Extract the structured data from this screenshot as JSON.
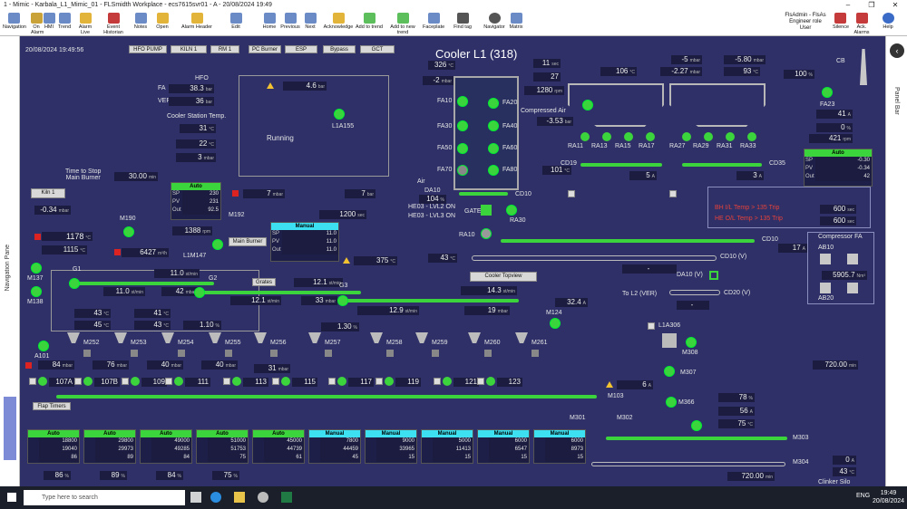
{
  "window": {
    "title": "1 - Mimic - Karbala_L1_Mimic_01 - FLSmidth Workplace - ecs7615svr01 - A - 20/08/2024 19:49",
    "controls": [
      "–",
      "❐",
      "✕"
    ]
  },
  "ribbon": {
    "items": [
      "Navigation",
      "On Alarm",
      "HMI",
      "Trend",
      "Alarm Live",
      "Event Historian",
      "Notes",
      "Open",
      "Alarm Header",
      "Edit",
      "Home",
      "Previous",
      "Next",
      "Acknowledge",
      "Add to trend",
      "Add to new trend",
      "Faceplate",
      "Find tag",
      "Navigator",
      "Matrix"
    ],
    "user": "FlsAdmin - FlsAs",
    "role": "Engineer role",
    "user_sub": "User",
    "right": [
      "Silence",
      "Ack. Alarms",
      "Help"
    ]
  },
  "nav_pane": "Navigation Pane",
  "right_pane": "Panel Bar",
  "header": {
    "datetime": "20/08/2024 19:49:56",
    "title": "Cooler L1 (318)",
    "buttons": [
      "HFO PUMP",
      "KILN 1",
      "RM 1",
      "PC Burner",
      "ESP",
      "Bypass",
      "GCT"
    ]
  },
  "hfo": {
    "title": "HFO",
    "fa": "38.3",
    "ver": "36",
    "fa_lbl": "FA",
    "ver_lbl": "VER",
    "unit": "bar",
    "station": "Cooler Station Temp.",
    "temp": "31",
    "unit_c": "°C"
  },
  "running": {
    "pressure": "4.6",
    "unit": "bar",
    "status": "Running",
    "tag": "L1A155"
  },
  "left": {
    "v1": "22",
    "v2": "3",
    "unit_c": "°C",
    "unit_mb": "mbar",
    "time_stop_lbl": "Time to Stop\nMain Burner",
    "time_stop": "30.00",
    "min": "min",
    "kiln_btn": "Kiln 1",
    "kiln_p": "-0.34",
    "m190": "M190",
    "m192": "M192",
    "rpm": "1388",
    "rpm_u": "rpm",
    "t1178": "1178",
    "t1115": "1115",
    "flow": "6427",
    "flow_u": "m³/h",
    "l1m147": "L1M147",
    "m137": "M137",
    "m138": "M138",
    "p7": "7",
    "p7b": "7",
    "bar": "bar",
    "v1200": "1200",
    "sec": "sec"
  },
  "main_burner": {
    "btn": "Main Burner",
    "mode": "Manual",
    "sp": "11.0",
    "pv": "11.0",
    "out": "11.0",
    "unit": "st/min",
    "p375": "375"
  },
  "auto_box1": {
    "mode": "Auto",
    "sp": "230",
    "pv": "231",
    "out": "92.5",
    "u_sp": "mbar",
    "u_out": "%"
  },
  "grates": {
    "g1": "G1",
    "g2": "G2",
    "g3": "G3",
    "v11a": "11.0",
    "v11b": "11.0",
    "v12a": "12.1",
    "v12b": "12.1",
    "v42": "42",
    "v33": "33",
    "v14": "14.3",
    "v12_9": "12.9",
    "v19": "19",
    "btn": "Grates",
    "top": "Cooler Topview",
    "unit": "st/min",
    "mbar": "mbar"
  },
  "bottom_left": {
    "a": "43",
    "b": "45",
    "c": "41",
    "d": "43",
    "e": "1.10",
    "f": "1.30",
    "g": "32.4",
    "unit_c": "°C",
    "pct": "%",
    "amp": "A",
    "m124": "M124"
  },
  "cooler": {
    "t326": "326",
    "t2": "-2",
    "v11": "11",
    "v27": "27",
    "v1280": "1280",
    "comp_air": "Compressed Air",
    "comp_val": "-3.53",
    "fans": [
      "FA10",
      "FA30",
      "FA50",
      "FA70",
      "FA20",
      "FA40",
      "FA60",
      "FA80"
    ],
    "air": "Air",
    "da10": "DA10",
    "v104": "104",
    "cd10": "CD10",
    "gate": "GATE",
    "ra30": "RA30",
    "ra10": "RA10",
    "he1": "HE03 - LVL2 ON",
    "he2": "HE03 - LVL3 ON",
    "t43": "43",
    "sec": "sec"
  },
  "esp": {
    "v106": "106",
    "v227": "-2.27",
    "v5": "-5",
    "v580": "-5.80",
    "v93": "93",
    "v100": "100",
    "c8": "CB",
    "fa23": "FA23",
    "v41": "41",
    "v0": "0",
    "v421": "421",
    "rpm": "rpm",
    "fans": [
      "RA11",
      "RA13",
      "RA15",
      "RA17",
      "RA27",
      "RA29",
      "RA31",
      "RA33"
    ],
    "cd19": "CD19",
    "cd35": "CD35",
    "a5": "5",
    "a3": "3",
    "t101": "101",
    "cd10b": "CD10",
    "t17": "17",
    "cd10v": "CD10 (V)",
    "cd20v": "CD20 (V)",
    "da10v": "DA10 (V)",
    "to_l2": "To L2 (VER)",
    "dash": "-"
  },
  "esp_ctrl": {
    "mode": "Auto",
    "sp": "-0.30",
    "pv": "-0.34",
    "out": "42",
    "u": "mbar"
  },
  "alarms": {
    "a1": "BH I/L Temp > 135 Trip",
    "a2": "HE O/L Temp > 135 Trip",
    "v600a": "600",
    "v600b": "600",
    "sec": "sec"
  },
  "compressor": {
    "title": "Compressor FA",
    "ab10": "AB10",
    "ab20": "AB20",
    "val": "5905.7",
    "unit": "Nm³"
  },
  "clinker": {
    "l1a306": "L1A306",
    "m308": "M308",
    "m307": "M307",
    "m366": "M366",
    "m103": "M103",
    "v6": "6",
    "t720": "720.00",
    "min": "min",
    "v78": "78",
    "v56": "56",
    "v75": "75",
    "m301": "M301",
    "m302": "M302",
    "m303": "M303",
    "m304": "M304",
    "v0b": "0",
    "v43": "43",
    "t720b": "720.00",
    "silo": "Clinker Silo",
    "flap": "Flap Timers"
  },
  "mflaps": [
    "M252",
    "M253",
    "M254",
    "M255",
    "M256",
    "M257",
    "M258",
    "M259",
    "M260",
    "M261"
  ],
  "flows": [
    {
      "tag": "A101",
      "v": "84"
    },
    {
      "tag": "",
      "v": "76"
    },
    {
      "tag": "",
      "v": "40"
    },
    {
      "tag": "",
      "v": "40"
    },
    {
      "tag": "",
      "v": "31"
    }
  ],
  "valves": [
    "107A",
    "107B",
    "109",
    "111",
    "113",
    "115",
    "117",
    "119",
    "121",
    "123"
  ],
  "fan_ctrls": [
    {
      "mode": "Auto",
      "sp": "18800",
      "pv": "19040",
      "out": "86"
    },
    {
      "mode": "Auto",
      "sp": "29800",
      "pv": "29973",
      "out": "89"
    },
    {
      "mode": "Auto",
      "sp": "49000",
      "pv": "49285",
      "out": "84"
    },
    {
      "mode": "Auto",
      "sp": "51000",
      "pv": "51753",
      "out": "75"
    },
    {
      "mode": "Auto",
      "sp": "45000",
      "pv": "44739",
      "out": "61"
    },
    {
      "mode": "Manual",
      "sp": "7800",
      "pv": "44459",
      "out": "45"
    },
    {
      "mode": "Manual",
      "sp": "9000",
      "pv": "33965",
      "out": "15"
    },
    {
      "mode": "Manual",
      "sp": "5000",
      "pv": "11413",
      "out": "15"
    },
    {
      "mode": "Manual",
      "sp": "6000",
      "pv": "6547",
      "out": "15"
    },
    {
      "mode": "Manual",
      "sp": "6000",
      "pv": "8973",
      "out": "15"
    }
  ],
  "bottom_pct": [
    "86",
    "89",
    "84",
    "75"
  ],
  "units": {
    "flow": "m³/h",
    "pct": "%"
  },
  "taskbar": {
    "search": "Type here to search",
    "time": "19:49",
    "date": "20/08/2024",
    "lang": "ENG"
  },
  "colors": {
    "bg": "#2e3067",
    "green": "#3cd43c",
    "auto": "#3cd43c",
    "manual": "#3de0f0"
  }
}
